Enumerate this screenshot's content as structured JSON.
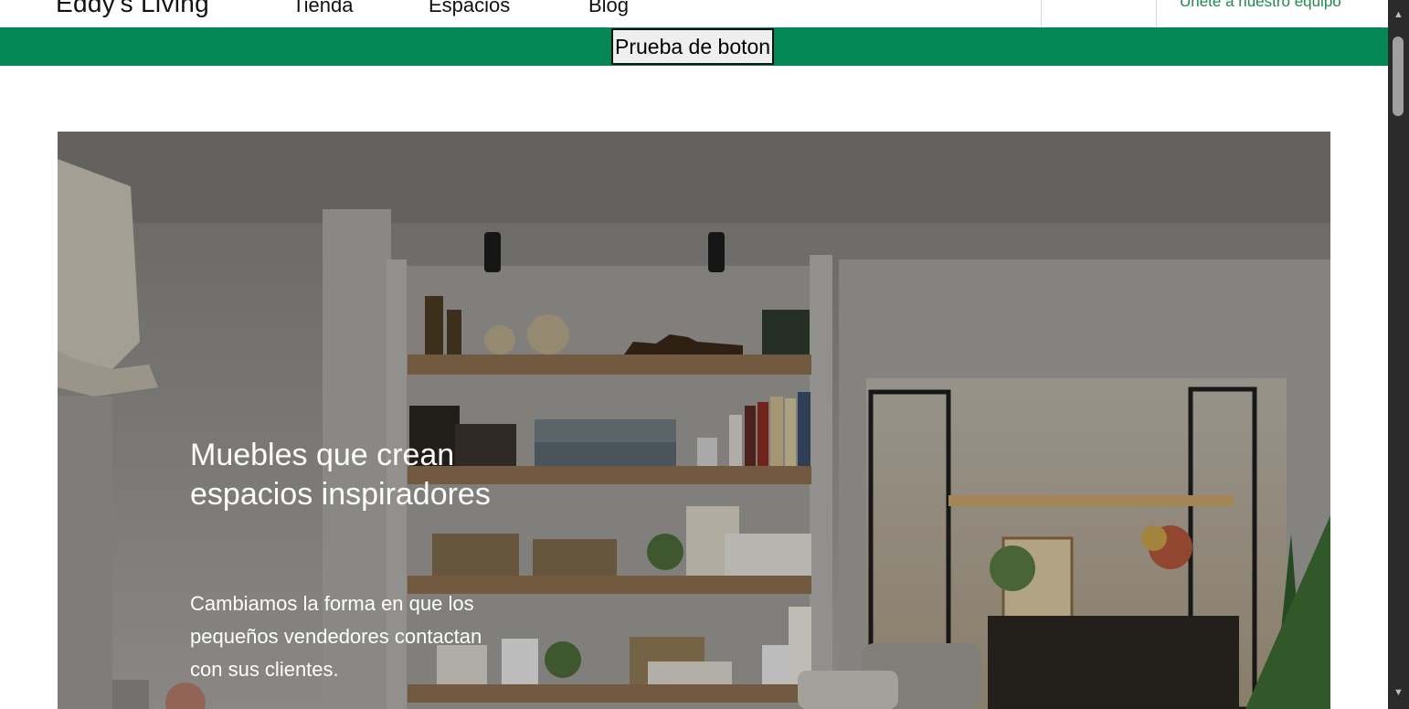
{
  "header": {
    "brand": "Eddy's Living",
    "nav": {
      "tienda": "Tienda",
      "espacios": "Espacios",
      "blog": "Blog"
    },
    "join_link": "Únete a nuestro equipo"
  },
  "banner": {
    "button_label": "Prueba de boton"
  },
  "hero": {
    "title": "Muebles que crean espacios inspiradores",
    "text": "Cambiamos la forma en que los pequeños vendedores contactan con sus clientes."
  },
  "scrollbar": {
    "up_icon": "▲",
    "down_icon": "▼"
  },
  "colors": {
    "accent_green": "#028755",
    "link_green": "#1f8a4c"
  }
}
